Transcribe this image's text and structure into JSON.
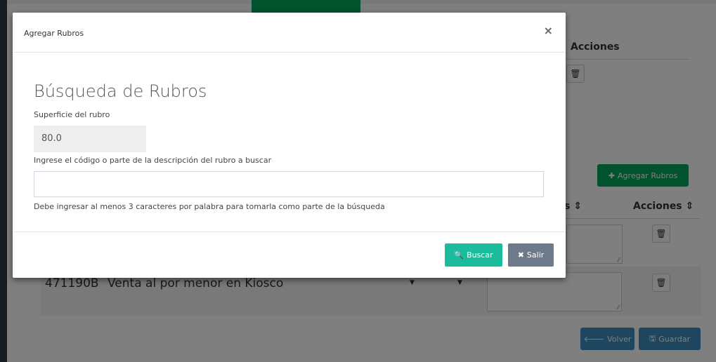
{
  "background": {
    "header_actions_top": "Acciones",
    "add_rubros_button": "Agregar Rubros",
    "header_sort_partial": "s ⇕",
    "header_actions_sorted": "Acciones ⇕",
    "row_code": "471190B",
    "row_description": "Venta al por menor en Kiosco",
    "volver_button": "Volver",
    "guardar_button": "Guardar",
    "icons": {
      "trash": "trash-icon",
      "plus": "plus-icon",
      "arrow_left": "arrow-left-icon",
      "save": "save-icon"
    }
  },
  "modal": {
    "title": "Agregar Rubros",
    "close_symbol": "×",
    "section_title": "Búsqueda de Rubros",
    "surface_label": "Superficie del rubro",
    "surface_value": "80.0",
    "search_label": "Ingrese el código o parte de la descripción del rubro a buscar",
    "search_value": "",
    "hint": "Debe ingresar al menos 3 caracteres por palabra para tomarla como parte de la búsqueda",
    "buscar_button": "Buscar",
    "salir_button": "Salir"
  },
  "colors": {
    "green": "#00a65a",
    "blue": "#3c8dbc",
    "teal": "#1abc9c",
    "gray": "#6c7a89"
  }
}
